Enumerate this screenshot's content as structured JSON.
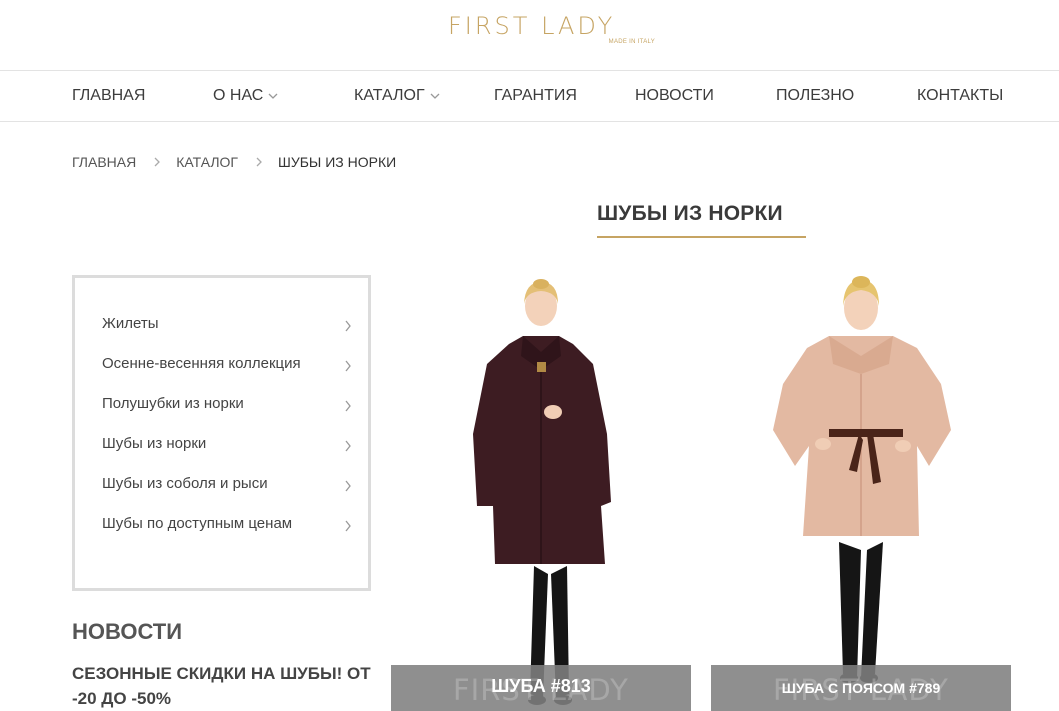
{
  "logo": {
    "text": "FIRST LADY",
    "tagline": "MADE IN ITALY",
    "color": "#c6a463"
  },
  "nav": {
    "items": [
      {
        "label": "ГЛАВНАЯ",
        "has_dropdown": false
      },
      {
        "label": "О НАС",
        "has_dropdown": true
      },
      {
        "label": "КАТАЛОГ",
        "has_dropdown": true
      },
      {
        "label": "ГАРАНТИЯ",
        "has_dropdown": false
      },
      {
        "label": "НОВОСТИ",
        "has_dropdown": false
      },
      {
        "label": "ПОЛЕЗНО",
        "has_dropdown": false
      },
      {
        "label": "КОНТАКТЫ",
        "has_dropdown": false
      }
    ]
  },
  "breadcrumb": {
    "home": "ГЛАВНАЯ",
    "catalog": "КАТАЛОГ",
    "current": "ШУБЫ ИЗ НОРКИ"
  },
  "page": {
    "title": "ШУБЫ ИЗ НОРКИ",
    "accent": "#c6a463"
  },
  "categories": [
    "Жилеты",
    "Осенне-весенняя коллекция",
    "Полушубки из норки",
    "Шубы из норки",
    "Шубы из соболя и рыси",
    "Шубы по доступным ценам"
  ],
  "news": {
    "heading": "НОВОСТИ",
    "items": [
      {
        "title": "СЕЗОННЫЕ СКИДКИ НА ШУБЫ! ОТ -20 ДО -50%"
      }
    ]
  },
  "products": [
    {
      "name": "ШУБА #813",
      "watermark": "FIRST LADY",
      "coat_color": "#3d1c22"
    },
    {
      "name": "ШУБА С ПОЯСОМ #789",
      "watermark": "FIRST LADY",
      "coat_color": "#e3b9a2"
    }
  ]
}
